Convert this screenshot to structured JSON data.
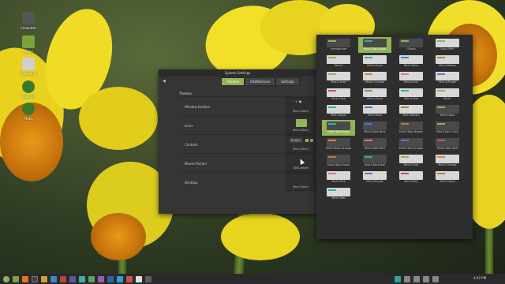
{
  "desktop": {
    "icons": [
      {
        "label": "Computer",
        "color": "#555555"
      },
      {
        "label": "Home",
        "color": "#7aa33a"
      },
      {
        "label": "Read Only",
        "color": "#cfcfcf"
      },
      {
        "label": "Pixel 3A",
        "color": "#3a7a2a"
      },
      {
        "label": "PIXEL",
        "color": "#3a7a2a"
      }
    ]
  },
  "settings": {
    "title": "System Settings",
    "back_icon": "back-arrow-icon",
    "tabs": [
      "Themes",
      "Add/Remove",
      "Settings"
    ],
    "active_tab": "Themes",
    "section": "Themes",
    "rows": [
      {
        "label": "Window borders",
        "value": "Mint-Y-Dark"
      },
      {
        "label": "Icons",
        "value": "Mint-Y-Dark"
      },
      {
        "label": "Controls",
        "value": "Mint-Y-Dark",
        "control_text": "Button"
      },
      {
        "label": "Mouse Pointer",
        "value": "DMZ-White"
      },
      {
        "label": "Desktop",
        "value": "Mint-Y-Dark"
      }
    ],
    "accent": "#8fb558"
  },
  "themes_panel": {
    "items": [
      "Unmaximize",
      "Mint-Y-Dark-Aqua",
      "CBlack",
      "Linux Mint",
      "Mint-X",
      "Mint-X-Aqua",
      "Mint-X-Blue",
      "Mint-X-Brown",
      "Mint-X-Grey",
      "Mint-X-Orange",
      "Mint-X-Pink",
      "Mint-X-Purple",
      "Mint-X-Red",
      "Mint-X-Sand",
      "Mint-X-Teal",
      "Mint-Y",
      "Mint-Y-Aqua",
      "Mint-Y-Blue",
      "Mint-Y-Brown",
      "Mint-Y-Dark",
      "Mint-Y-Dark-Aqua",
      "Mint-Y-Dark-Blue",
      "Mint-Y-Dark-Brown",
      "Mint-Y-Dark-Grey",
      "Mint-Y-Dark-Orange",
      "Mint-Y-Dark-Pink",
      "Mint-Y-Dark-Purple",
      "Mint-Y-Dark-Red",
      "Mint-Y-Dark-Sand",
      "Mint-Y-Dark-Teal",
      "Mint-Y-Grey",
      "Mint-Y-Orange",
      "Mint-Y-Pink",
      "Mint-Y-Purple",
      "Mint-Y-Red",
      "Mint-Y-Sand",
      "Mint-Y-Teal"
    ],
    "selected": "Mint-Y-Dark-Aqua"
  },
  "taskbar": {
    "clock": "4:02 PM",
    "apps": [
      "menu-icon",
      "files-icon",
      "firefox-icon",
      "terminal-icon",
      "folder-icon",
      "text-editor-icon",
      "image-viewer-icon",
      "settings-icon",
      "software-icon",
      "system-monitor-icon",
      "music-icon",
      "video-icon",
      "chat-icon",
      "mail-icon",
      "calendar-icon",
      "store-icon"
    ]
  }
}
